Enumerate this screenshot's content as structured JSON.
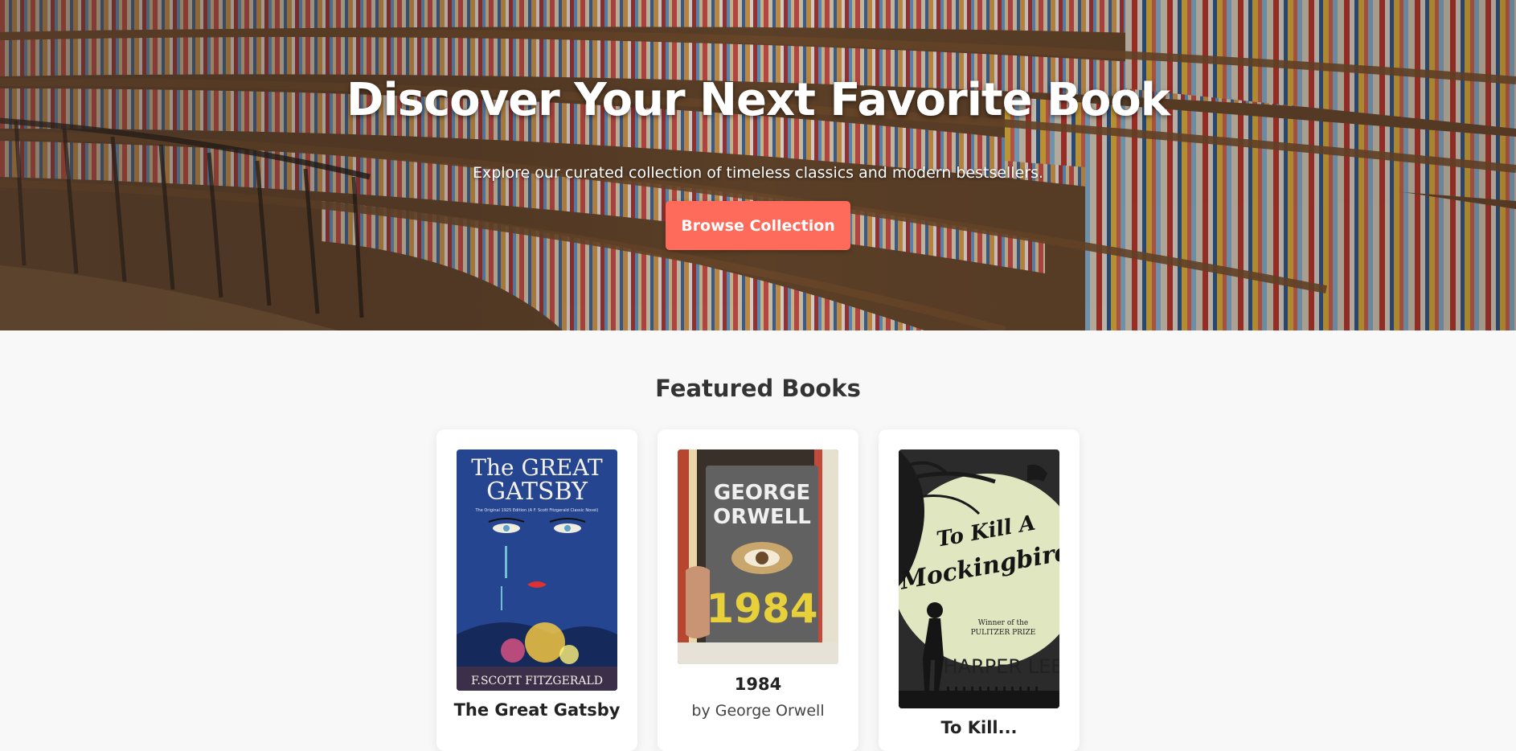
{
  "hero": {
    "title": "Discover Your Next Favorite Book",
    "subtitle": "Explore our curated collection of timeless classics and modern bestsellers.",
    "cta_label": "Browse Collection",
    "accent_color": "#ff6b5b"
  },
  "featured": {
    "heading": "Featured Books",
    "books": [
      {
        "title": "The Great Gatsby",
        "author": "",
        "cover": {
          "line1": "The GREAT",
          "line2": "GATSBY",
          "tagline": "The Original 1925 Edition (A F. Scott Fitzgerald Classic Novel)",
          "author_text": "F.SCOTT FITZGERALD",
          "color": "#2a4d9c"
        }
      },
      {
        "title": "1984",
        "author": "by George Orwell",
        "cover": {
          "line1": "GEORGE",
          "line2": "ORWELL",
          "number": "1984",
          "color": "#5a5a5a"
        }
      },
      {
        "title": "To Kill...",
        "author": "",
        "cover": {
          "line1": "To Kill A",
          "line2": "Mockingbird",
          "award_line1": "Winner of the",
          "award_line2": "PULITZER PRIZE",
          "author_text": "HARPER LEE",
          "color": "#dfe6c0"
        }
      }
    ]
  }
}
